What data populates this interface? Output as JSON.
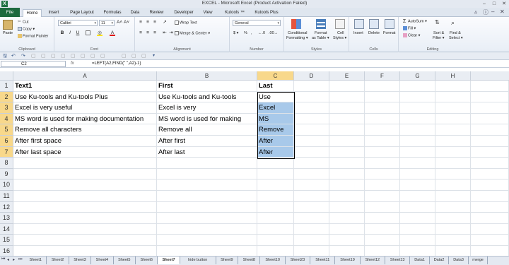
{
  "window": {
    "title": "EXCEL - Microsoft Excel (Product Activation Failed)"
  },
  "tabs": [
    "File",
    "Home",
    "Insert",
    "Page Layout",
    "Formulas",
    "Data",
    "Review",
    "Developer",
    "View",
    "Kutools ™",
    "Kutools Plus"
  ],
  "ribbon": {
    "clipboard": {
      "label": "Clipboard",
      "paste": "Paste",
      "cut": "Cut",
      "copy": "Copy ▾",
      "format_painter": "Format Painter"
    },
    "font": {
      "label": "Font",
      "name": "Calibri",
      "size": "11",
      "grow": "A˄",
      "shrink": "A˅",
      "bold": "B",
      "italic": "I",
      "underline": "U"
    },
    "alignment": {
      "label": "Alignment",
      "wrap_text": "Wrap Text",
      "merge": "Merge & Center ▾"
    },
    "number": {
      "label": "Number",
      "format": "General",
      "currency": "$ ▾",
      "percent": "%",
      "comma": ","
    },
    "styles": {
      "label": "Styles",
      "conditional": "Conditional",
      "conditional2": "Formatting ▾",
      "format_table": "Format",
      "format_table2": "as Table ▾",
      "cell_styles": "Cell",
      "cell_styles2": "Styles ▾"
    },
    "cells": {
      "label": "Cells",
      "insert": "Insert",
      "delete": "Delete",
      "format": "Format"
    },
    "editing": {
      "label": "Editing",
      "autosum": "AutoSum ▾",
      "fill": "Fill ▾",
      "clear": "Clear ▾",
      "sort": "Sort &",
      "sort2": "Filter ▾",
      "find": "Find &",
      "find2": "Select ▾"
    }
  },
  "formula_bar": {
    "name_box": "C2",
    "fx": "fx",
    "formula": "=LEFT(A2,FIND(\" \",A2)-1)"
  },
  "columns": [
    "A",
    "B",
    "C",
    "D",
    "E",
    "F",
    "G",
    "H"
  ],
  "rows": [
    "1",
    "2",
    "3",
    "4",
    "5",
    "6",
    "7",
    "8",
    "9",
    "10",
    "11",
    "12",
    "13",
    "14",
    "15",
    "16"
  ],
  "cells": {
    "A": [
      "Text1",
      "Use Ku-tools and Ku-tools Plus",
      "Excel is very useful",
      "MS word is used for making documentation",
      "Remove all characters",
      "After first space",
      "After last space"
    ],
    "B": [
      "First",
      "Use Ku-tools and Ku-tools",
      "Excel is very",
      "MS word is used for making",
      "Remove all",
      "After first",
      "After last"
    ],
    "C": [
      "Last",
      "Use",
      "Excel",
      "MS",
      "Remove",
      "After",
      "After"
    ]
  },
  "sheets": [
    "Sheet1",
    "Sheet2",
    "Sheet3",
    "Sheet4",
    "Sheet5",
    "Sheet6",
    "Sheet7",
    "hide button",
    "Sheet9",
    "Sheet8",
    "Sheet10",
    "Sheet23",
    "Sheet11",
    "Sheet19",
    "Sheet12",
    "Sheet13",
    "Data1",
    "Data2",
    "Data3",
    "merge"
  ],
  "active_sheet": "Sheet7",
  "colors": {
    "excel_green": "#1e6a3f",
    "selection_fill": "#a8c9ea",
    "header_selected": "#f8d88b"
  }
}
